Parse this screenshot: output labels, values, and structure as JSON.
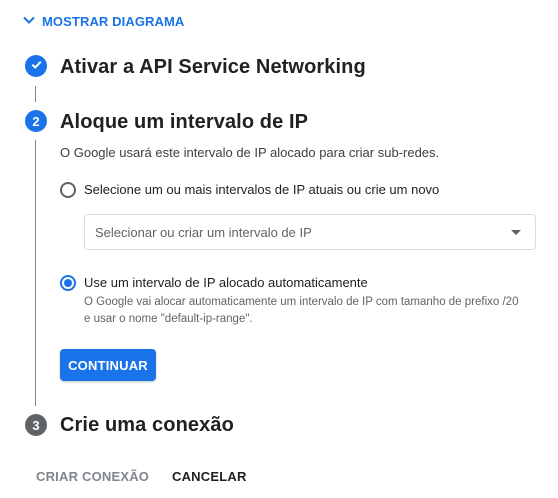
{
  "toggle": {
    "label": "MOSTRAR DIAGRAMA",
    "icon": "chevron-down-icon"
  },
  "steps": [
    {
      "marker": "",
      "title": "Ativar a API Service Networking",
      "state": "completed"
    },
    {
      "marker": "2",
      "title": "Aloque um intervalo de IP",
      "state": "active"
    },
    {
      "marker": "3",
      "title": "Crie uma conexão",
      "state": "inactive"
    }
  ],
  "step2": {
    "description": "O Google usará este intervalo de IP alocado para criar sub-redes.",
    "options": [
      {
        "label": "Selecione um ou mais intervalos de IP atuais ou crie um novo",
        "selected": false
      },
      {
        "label": "Use um intervalo de IP alocado automaticamente",
        "help": "O Google vai alocar automaticamente um intervalo de IP com tamanho de prefixo /20 e usar o nome \"default-ip-range\".",
        "selected": true
      }
    ],
    "select_placeholder": "Selecionar ou criar um intervalo de IP",
    "continue_label": "CONTINUAR"
  },
  "footer": {
    "create_label": "CRIAR CONEXÃO",
    "cancel_label": "CANCELAR"
  },
  "colors": {
    "accent": "#1a73e8",
    "inactive_marker": "#5f6368",
    "disabled_text": "#80868b"
  }
}
